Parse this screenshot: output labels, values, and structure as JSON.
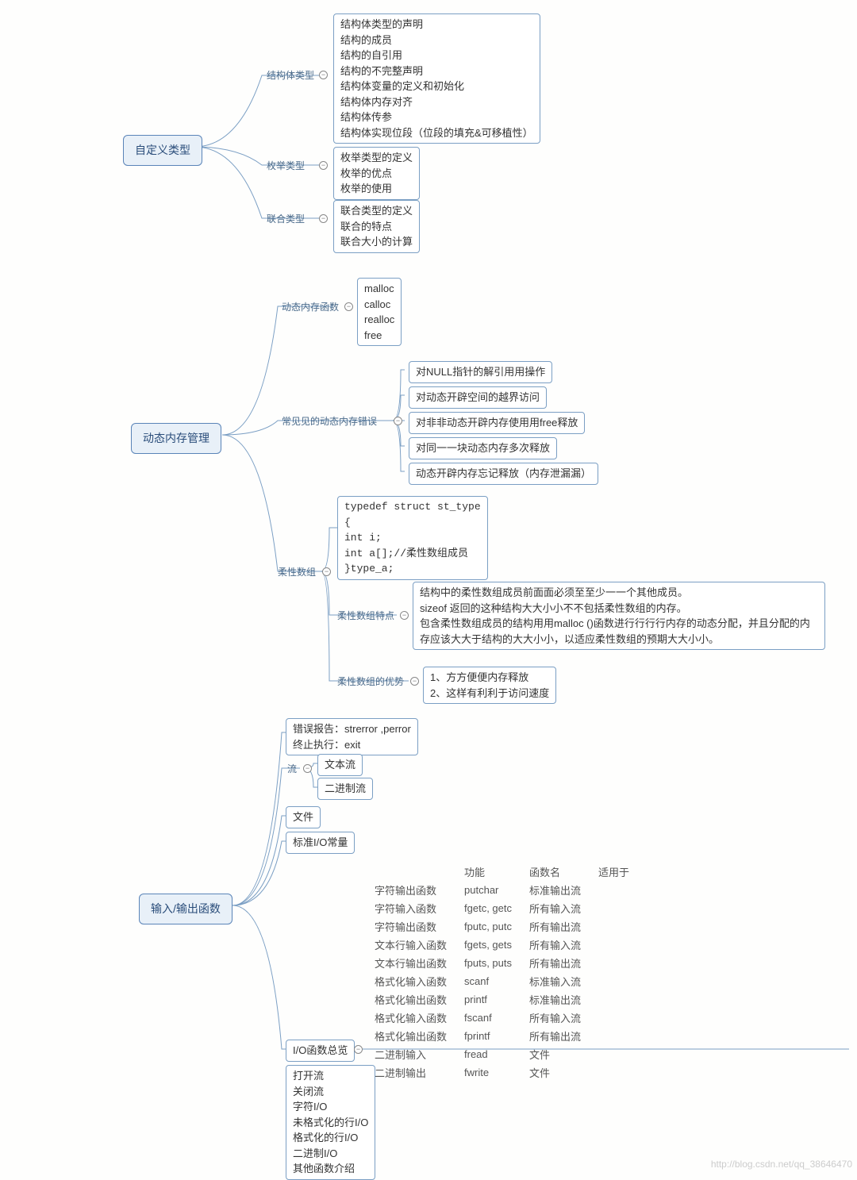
{
  "roots": {
    "r1": "自定义类型",
    "r2": "动态内存管理",
    "r3": "输入/输出函数"
  },
  "labels": {
    "struct": "结构体类型",
    "enum": "枚举类型",
    "union": "联合类型",
    "dynfn": "动态内存函数",
    "errs": "常见见的动态内存错误",
    "flex": "柔性数组",
    "flexfeat": "柔性数组特点",
    "flexadv": "柔性数组的优势",
    "stream": "流"
  },
  "boxes": {
    "struct": "结构体类型的声明\n结构的成员\n结构的自引用\n结构的不完整声明\n结构体变量的定义和初始化\n结构体内存对齐\n结构体传参\n结构体实现位段（位段的填充&可移植性）",
    "enum": "枚举类型的定义\n枚举的优点\n枚举的使用",
    "union": "联合类型的定义\n联合的特点\n联合大小的计算",
    "dynfn": "malloc\ncalloc\nrealloc\nfree",
    "e1": "对NULL指针的解引用用操作",
    "e2": "对动态开辟空间的越界访问",
    "e3": "对非非动态开辟内存使用用free释放",
    "e4": "对同一一块动态内存多次释放",
    "e5": "动态开辟内存忘记释放（内存泄漏漏）",
    "flexcode": "typedef struct st_type\n{\nint i;\nint a[];//柔性数组成员\n}type_a;",
    "flexfeat": "结构中的柔性数组成员前面面必须至至少一一个其他成员。\nsizeof 返回的这种结构大大小小不不包括柔性数组的内存。\n包含柔性数组成员的结构用用malloc ()函数进行行行行内存的动态分配，并且分配的内存应该大大于结构的大大小小，以适应柔性数组的预期大大小小。",
    "flexadv": "1、方方便便内存释放\n2、这样有利利于访问速度",
    "io1": "错误报告：strerror ,perror\n终止执行：exit",
    "stream1": "文本流",
    "stream2": "二进制流",
    "file": "文件",
    "ioconst": "标准I/O常量",
    "iooverview": "I/O函数总览",
    "io3": "打开流\n关闭流\n字符I/O\n未格式化的行I/O\n格式化的行I/O\n二进制I/O\n其他函数介绍"
  },
  "iotbl": {
    "head": [
      "",
      "功能",
      "函数名",
      "适用于"
    ],
    "rows": [
      [
        "字符输出函数",
        "putchar",
        "标准输出流"
      ],
      [
        "字符输入函数",
        "fgetc, getc",
        "所有输入流"
      ],
      [
        "字符输出函数",
        "fputc, putc",
        "所有输出流"
      ],
      [
        "文本行输入函数",
        "fgets, gets",
        "所有输入流"
      ],
      [
        "文本行输出函数",
        "fputs, puts",
        "所有输出流"
      ],
      [
        "格式化输入函数",
        "scanf",
        "标准输入流"
      ],
      [
        "格式化输出函数",
        "printf",
        "标准输出流"
      ],
      [
        "格式化输入函数",
        "fscanf",
        "所有输入流"
      ],
      [
        "格式化输出函数",
        "fprintf",
        "所有输出流"
      ],
      [
        "二进制输入",
        "fread",
        "文件"
      ],
      [
        "二进制输出",
        "fwrite",
        "文件"
      ]
    ]
  },
  "watermark": "http://blog.csdn.net/qq_38646470"
}
